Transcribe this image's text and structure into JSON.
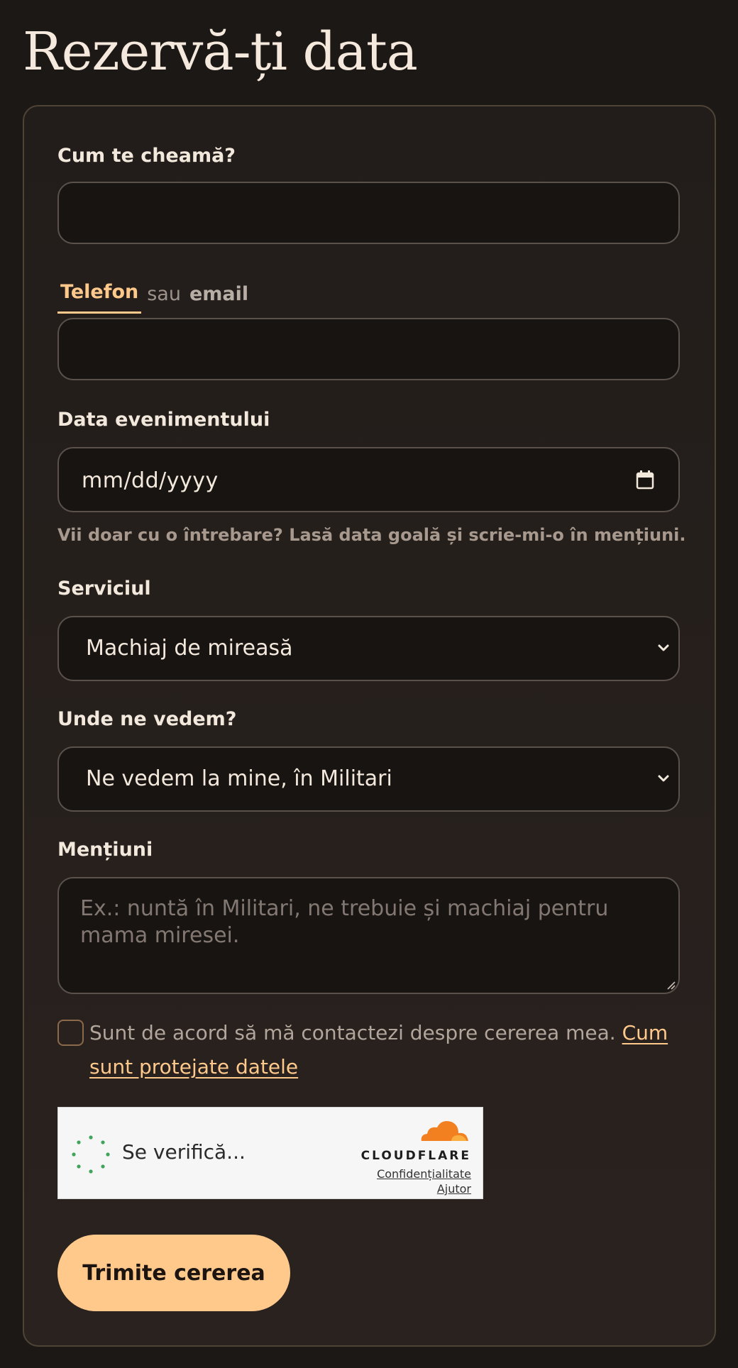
{
  "page": {
    "title": "Rezervă-ți data"
  },
  "form": {
    "name": {
      "label": "Cum te cheamă?",
      "value": "",
      "placeholder": ""
    },
    "contact": {
      "tab_phone": "Telefon",
      "tab_separator": "sau",
      "tab_email": "email",
      "active_tab": "Telefon",
      "value": "",
      "placeholder": ""
    },
    "event_date": {
      "label": "Data evenimentului",
      "value": "mm/dd/yyyy",
      "help": "Vii doar cu o întrebare? Lasă data goală și scrie-mi-o în mențiuni."
    },
    "service": {
      "label": "Serviciul",
      "selected": "Machiaj de mireasă"
    },
    "location": {
      "label": "Unde ne vedem?",
      "selected": "Ne vedem la mine, în Militari"
    },
    "notes": {
      "label": "Mențiuni",
      "placeholder": "Ex.: nuntă în Militari, ne trebuie și machiaj pentru mama miresei."
    },
    "consent": {
      "text": "Sunt de acord să mă contactezi despre cererea mea.",
      "link": "Cum sunt protejate datele",
      "checked": false
    },
    "captcha": {
      "status": "Se verifică...",
      "brand": "CLOUDFLARE",
      "privacy_link": "Confidențialitate",
      "help_link": "Ajutor"
    },
    "submit_label": "Trimite cererea"
  },
  "colors": {
    "background": "#1c1816",
    "accent": "#ffc98c",
    "field_bg": "#181412",
    "border": "#5a514b"
  },
  "icons": {
    "calendar": "calendar-icon",
    "dropdown": "chevron-down-icon",
    "spinner": "spinner-icon",
    "cloudflare": "cloudflare-logo-icon"
  }
}
